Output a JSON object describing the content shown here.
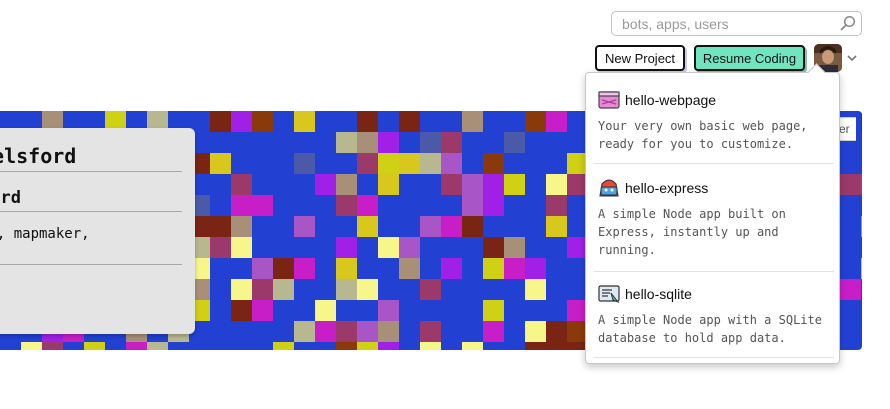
{
  "search": {
    "placeholder": "bots, apps, users"
  },
  "header": {
    "new_project_label": "New Project",
    "resume_coding_label": "Resume Coding"
  },
  "profile_card": {
    "name_text": "relsford",
    "login_text": "ford",
    "bio_text": "er, mapmaker,"
  },
  "banner": {
    "partial_button_label": "er"
  },
  "new_project_menu": {
    "items": [
      {
        "title": "hello-webpage",
        "icon": "webpage-icon",
        "description": "Your very own basic web page,\nready for you to customize."
      },
      {
        "title": "hello-express",
        "icon": "express-icon",
        "description": "A simple Node app built on\nExpress, instantly up and\nrunning."
      },
      {
        "title": "hello-sqlite",
        "icon": "sqlite-icon",
        "description": "A simple Node app with a SQLite\ndatabase to hold app data."
      }
    ]
  },
  "colors": {
    "resume_button": "#6fe5c0",
    "banner_blue": "#2241d3",
    "card_bg": "#e4e4e4"
  }
}
